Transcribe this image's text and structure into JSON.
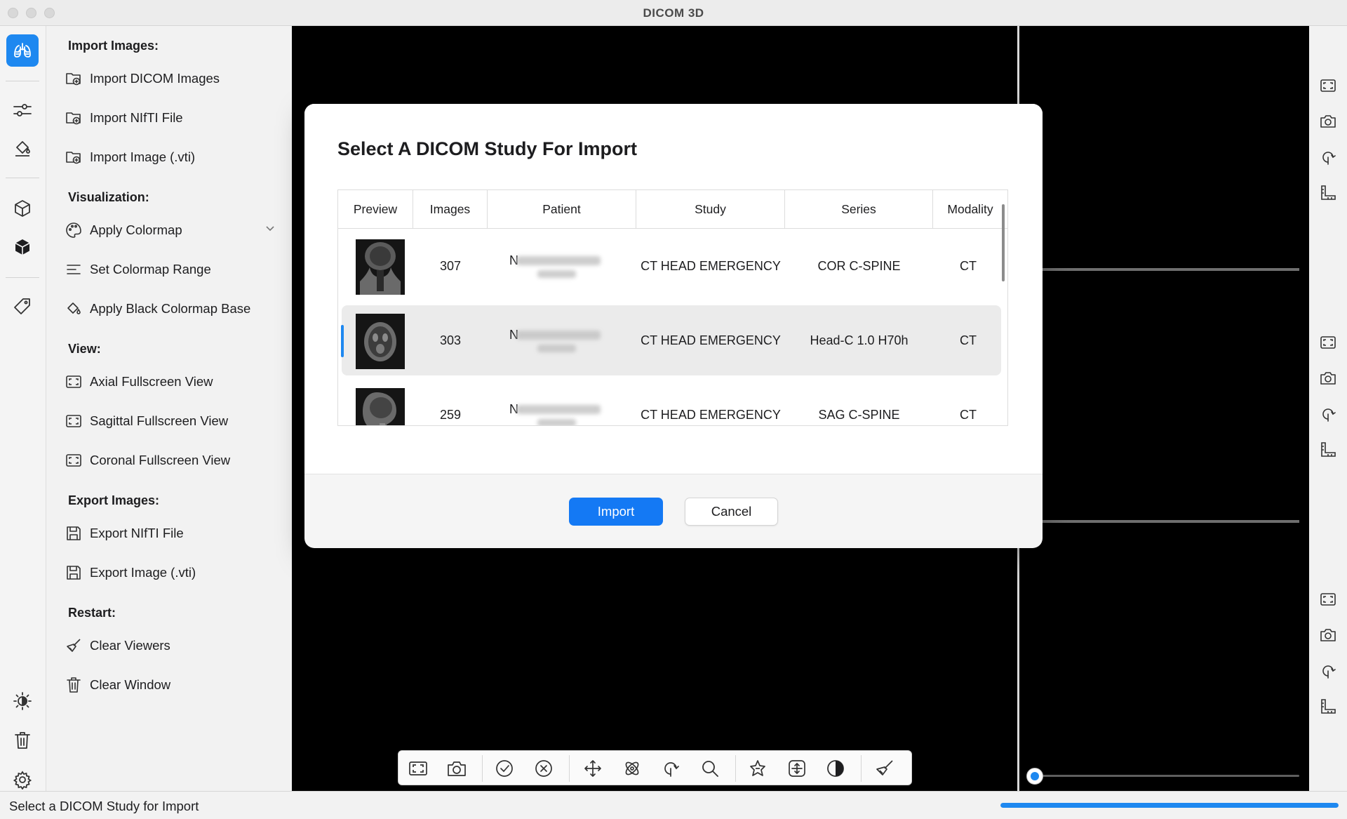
{
  "window": {
    "title": "DICOM 3D"
  },
  "menu": {
    "sections": [
      {
        "heading": "Import Images:",
        "items": [
          "Import DICOM Images",
          "Import NIfTI File",
          "Import Image (.vti)"
        ]
      },
      {
        "heading": "Visualization:",
        "items": [
          "Apply Colormap",
          "Set Colormap Range",
          "Apply Black Colormap Base"
        ]
      },
      {
        "heading": "View:",
        "items": [
          "Axial Fullscreen View",
          "Sagittal Fullscreen View",
          "Coronal Fullscreen View"
        ]
      },
      {
        "heading": "Export Images:",
        "items": [
          "Export NIfTI File",
          "Export Image (.vti)"
        ]
      },
      {
        "heading": "Restart:",
        "items": [
          "Clear Viewers",
          "Clear Window"
        ]
      }
    ]
  },
  "rail": {
    "icons": [
      "lungs-icon",
      "sliders-icon",
      "paint-bucket-icon",
      "cube-outline-icon",
      "cube-filled-icon",
      "tag-icon",
      "brightness-icon",
      "trash-icon",
      "gear-icon"
    ],
    "active_color": "#1e88f0"
  },
  "modal": {
    "title": "Select A DICOM Study For Import",
    "columns": [
      "Preview",
      "Images",
      "Patient",
      "Study",
      "Series",
      "Modality"
    ],
    "rows": [
      {
        "images": "307",
        "patient_initial": "N",
        "study": "CT  HEAD EMERGENCY",
        "series": "COR C-SPINE",
        "modality": "CT",
        "selected": false
      },
      {
        "images": "303",
        "patient_initial": "N",
        "study": "CT  HEAD EMERGENCY",
        "series": "Head-C  1.0  H70h",
        "modality": "CT",
        "selected": true
      },
      {
        "images": "259",
        "patient_initial": "N",
        "study": "CT  HEAD EMERGENCY",
        "series": "SAG C-SPINE",
        "modality": "CT",
        "selected": false
      }
    ],
    "import_label": "Import",
    "cancel_label": "Cancel"
  },
  "toolbar": {
    "icons": [
      "fullscreen-icon",
      "camera-icon",
      "check-circle-icon",
      "x-circle-icon",
      "move-icon",
      "rotate-3d-icon",
      "rotate-icon",
      "zoom-icon",
      "auto-fix-icon",
      "reset-view-icon",
      "contrast-icon",
      "brush-icon"
    ]
  },
  "right_tools": {
    "icons": [
      "fullscreen-icon",
      "camera-icon",
      "rotate-icon",
      "ruler-icon"
    ]
  },
  "status": {
    "text": "Select a DICOM Study for Import",
    "progress": 1.0
  },
  "colors": {
    "accent": "#1e88f0",
    "primary_button": "#1479f4",
    "viewer_bg": "#000000"
  }
}
